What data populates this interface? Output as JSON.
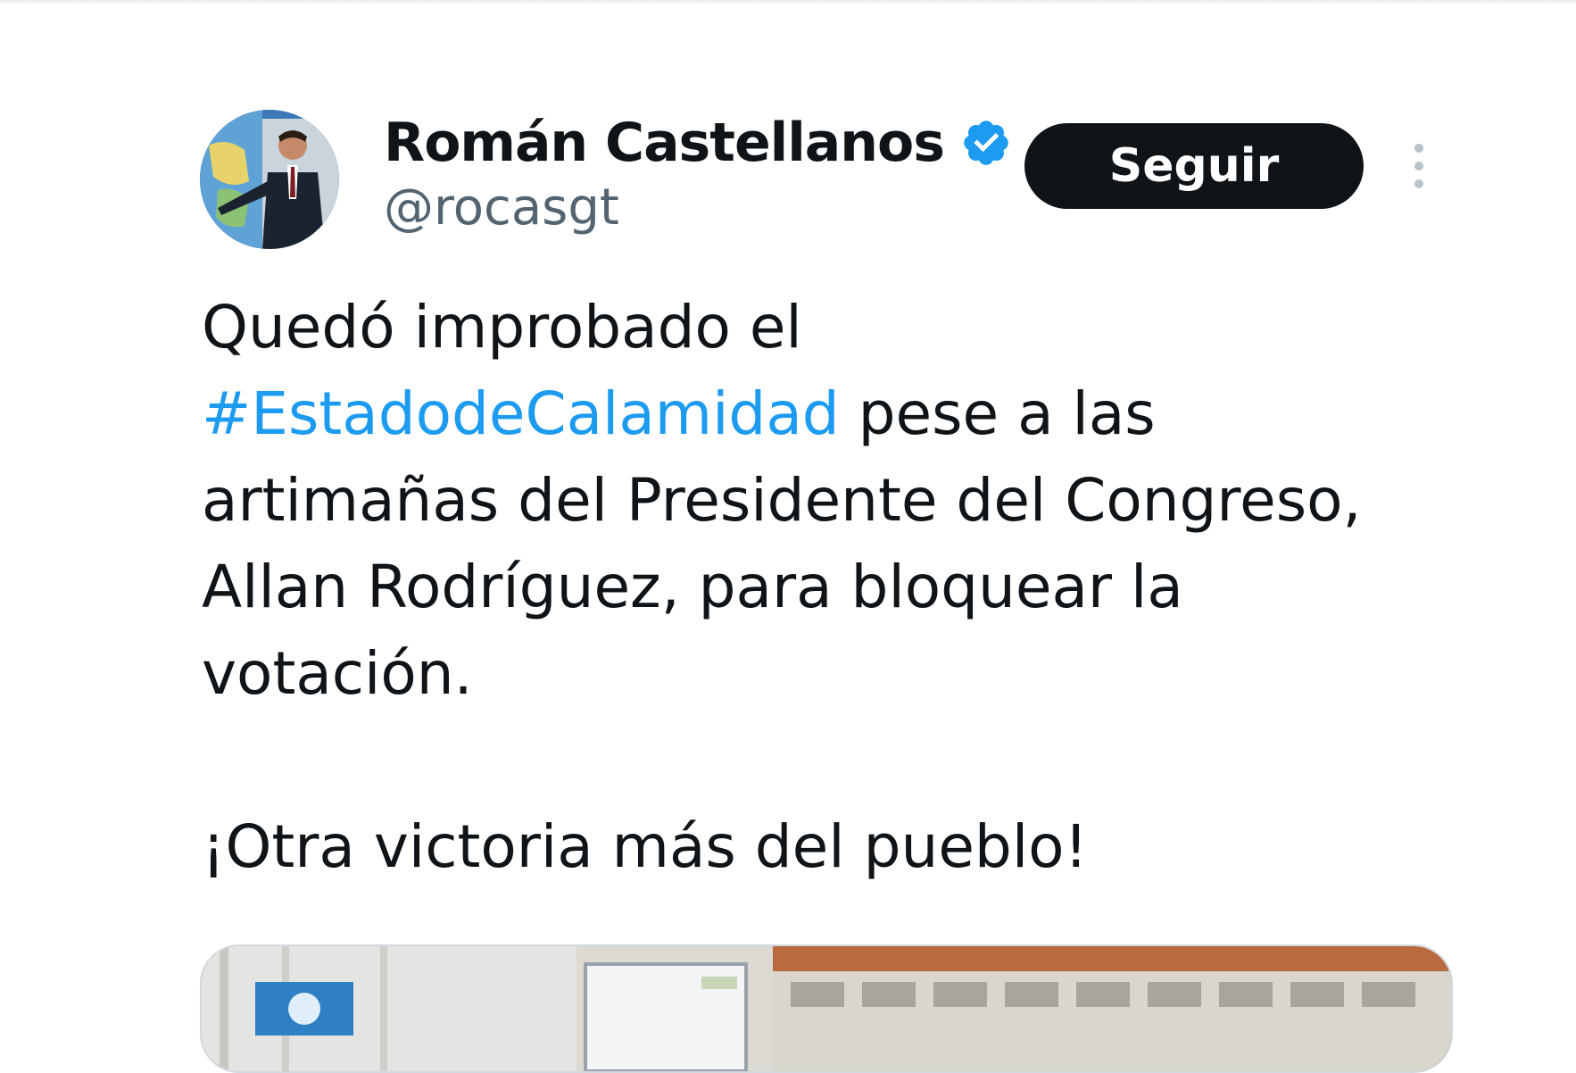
{
  "tweet": {
    "author": {
      "display_name": "Román Castellanos",
      "handle": "@rocasgt",
      "verified": true,
      "avatar_icon": "profile-photo"
    },
    "follow_label": "Seguir",
    "more_icon": "vertical-ellipsis-icon",
    "text": {
      "line1": "Quedó improbado el",
      "hashtag": "#EstadodeCalamidad",
      "after_hashtag": " pese a las artimañas del Presidente del Congreso, Allan Rodríguez, para bloquear la votación.",
      "closing": "¡Otra victoria más del pueblo!"
    },
    "colors": {
      "hashtag": "#1d9bf0",
      "verified_badge": "#1d9bf0",
      "follow_button_bg": "#0f1419",
      "handle": "#536471"
    }
  }
}
